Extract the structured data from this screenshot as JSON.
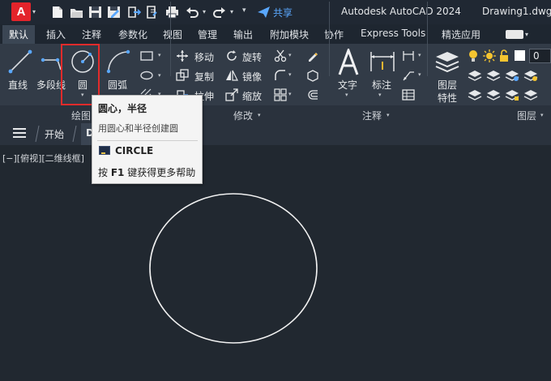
{
  "app": {
    "logo_letter": "A",
    "title_app": "Autodesk AutoCAD 2024",
    "title_file": "Drawing1.dwg",
    "share_label": "共享"
  },
  "tabs": [
    {
      "label": "默认",
      "active": true
    },
    {
      "label": "插入"
    },
    {
      "label": "注释"
    },
    {
      "label": "参数化"
    },
    {
      "label": "视图"
    },
    {
      "label": "管理"
    },
    {
      "label": "输出"
    },
    {
      "label": "附加模块"
    },
    {
      "label": "协作"
    },
    {
      "label": "Express Tools"
    },
    {
      "label": "精选应用"
    }
  ],
  "ribbon": {
    "draw": {
      "title": "绘图",
      "line": "直线",
      "polyline": "多段线",
      "circle": "圆",
      "arc": "圆弧"
    },
    "modify": {
      "title": "修改",
      "move": "移动",
      "rotate": "旋转",
      "copy": "复制",
      "mirror": "镜像",
      "stretch": "拉伸",
      "scale": "缩放"
    },
    "annotation": {
      "title": "注释",
      "text": "文字",
      "dimension": "标注"
    },
    "layers": {
      "title": "图层",
      "properties_line1": "图层",
      "properties_line2": "特性",
      "current_layer": "0"
    }
  },
  "doc_tabs": {
    "start": "开始",
    "active_initial": "D"
  },
  "viewport": {
    "label": "[−][俯视][二维线框]"
  },
  "tooltip": {
    "title": "圆心，半径",
    "description": "用圆心和半径创建圆",
    "command": "CIRCLE",
    "help_prefix": "按 ",
    "help_key": "F1",
    "help_suffix": " 键获得更多帮助"
  },
  "colors": {
    "accent_highlight": "#e32b2b",
    "ribbon_bg": "#323b47",
    "canvas_bg": "#212830",
    "share_blue": "#5aa8ff"
  },
  "icons": [
    "save-icon",
    "open-icon",
    "new-icon",
    "print-icon",
    "undo-icon",
    "redo-icon",
    "share-icon",
    "move-icon",
    "rotate-icon",
    "trim-icon",
    "copy-icon",
    "mirror-icon",
    "fillet-icon",
    "stretch-icon",
    "scale-icon",
    "array-icon",
    "text-icon",
    "dimension-icon",
    "layer-properties-icon",
    "lightbulb-icon",
    "sun-icon",
    "lock-icon"
  ]
}
